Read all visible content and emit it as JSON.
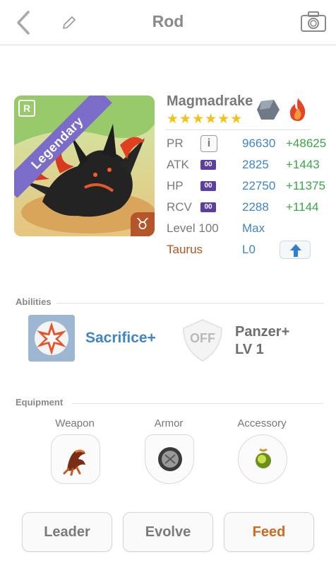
{
  "header": {
    "title": "Rod",
    "back_icon": "chevron-left-icon",
    "edit_icon": "pencil-icon",
    "camera_icon": "camera-icon"
  },
  "monster": {
    "name": "Magmadrake",
    "rarity": "Legendary",
    "rarity_color": "#7c6cc9",
    "r_badge": "R",
    "zodiac_symbol": "♉",
    "stars": "★★★★★★",
    "star_count": 6,
    "elements": [
      "rock-element-icon",
      "fire-element-icon"
    ],
    "stats": {
      "pr": {
        "label": "PR",
        "value": "96630",
        "bonus": "+48625"
      },
      "atk": {
        "label": "ATK",
        "badge": "00",
        "value": "2825",
        "bonus": "+1443"
      },
      "hp": {
        "label": "HP",
        "badge": "00",
        "value": "22750",
        "bonus": "+11375"
      },
      "rcv": {
        "label": "RCV",
        "badge": "00",
        "value": "2288",
        "bonus": "+1144"
      }
    },
    "level": {
      "label": "Level 100",
      "value": "Max"
    },
    "zodiac": {
      "label": "Taurus",
      "level": "L0"
    },
    "info_button": "i"
  },
  "abilities": {
    "section_label": "Abilities",
    "items": [
      {
        "name": "Sacrifice+"
      },
      {
        "name": "Panzer+",
        "level": "LV 1",
        "state": "OFF"
      }
    ]
  },
  "equipment": {
    "section_label": "Equipment",
    "slots": [
      {
        "label": "Weapon"
      },
      {
        "label": "Armor"
      },
      {
        "label": "Accessory"
      }
    ]
  },
  "actions": {
    "leader": "Leader",
    "evolve": "Evolve",
    "feed": "Feed"
  },
  "colors": {
    "accent_blue": "#3f86c6",
    "bonus_green": "#3aa54a",
    "feed_orange": "#d06a1e",
    "zodiac_brown": "#b3541f"
  }
}
